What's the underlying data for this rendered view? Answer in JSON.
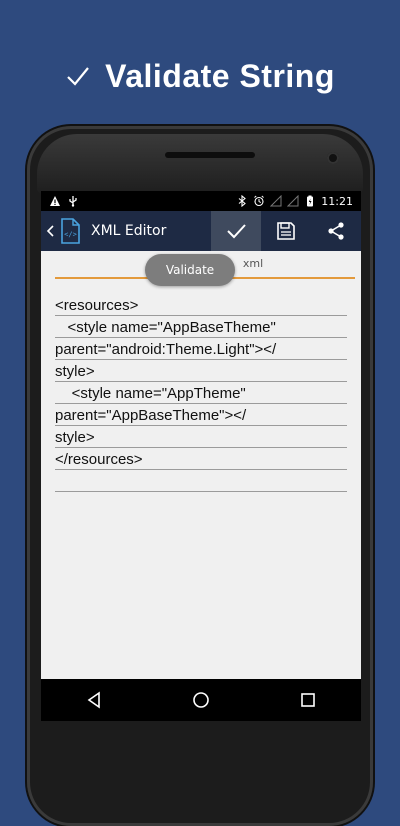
{
  "promo": {
    "title": "Validate String",
    "icon": "check-icon"
  },
  "statusbar": {
    "time": "11:21"
  },
  "actionbar": {
    "title": "XML Editor",
    "actions": [
      "validate-check-icon",
      "save-icon",
      "share-icon"
    ]
  },
  "document": {
    "filename": "xml"
  },
  "toast": {
    "text": "Validate"
  },
  "editor": {
    "lines": [
      "<resources>",
      "   <style name=\"AppBaseTheme\"",
      "parent=\"android:Theme.Light\"></",
      "style>",
      "    <style name=\"AppTheme\"",
      "parent=\"AppBaseTheme\"></",
      "style>",
      "</resources>",
      ""
    ]
  },
  "colors": {
    "background": "#2e4a7e",
    "actionbar": "#1e2a44",
    "accent": "#e39a3c"
  }
}
